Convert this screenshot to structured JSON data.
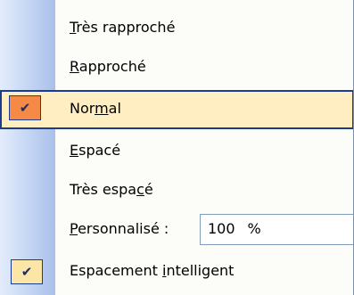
{
  "menu": {
    "items": [
      {
        "label_pre": "",
        "accel": "T",
        "label_post": "rès rapproché",
        "checked": false
      },
      {
        "label_pre": "",
        "accel": "R",
        "label_post": "approché",
        "checked": false
      },
      {
        "label_pre": "Nor",
        "accel": "m",
        "label_post": "al",
        "checked": true,
        "highlighted": true
      },
      {
        "label_pre": "",
        "accel": "E",
        "label_post": "spacé",
        "checked": false
      },
      {
        "label_pre": "Très espa",
        "accel": "c",
        "label_post": "é",
        "checked": false
      },
      {
        "label_pre": "",
        "accel": "P",
        "label_post": "ersonnalisé :",
        "checked": false,
        "input": {
          "value": "100",
          "unit": "%"
        }
      },
      {
        "label_pre": "Espacement ",
        "accel": "i",
        "label_post": "ntelligent",
        "checked": true
      }
    ],
    "check_glyph": "✔"
  }
}
